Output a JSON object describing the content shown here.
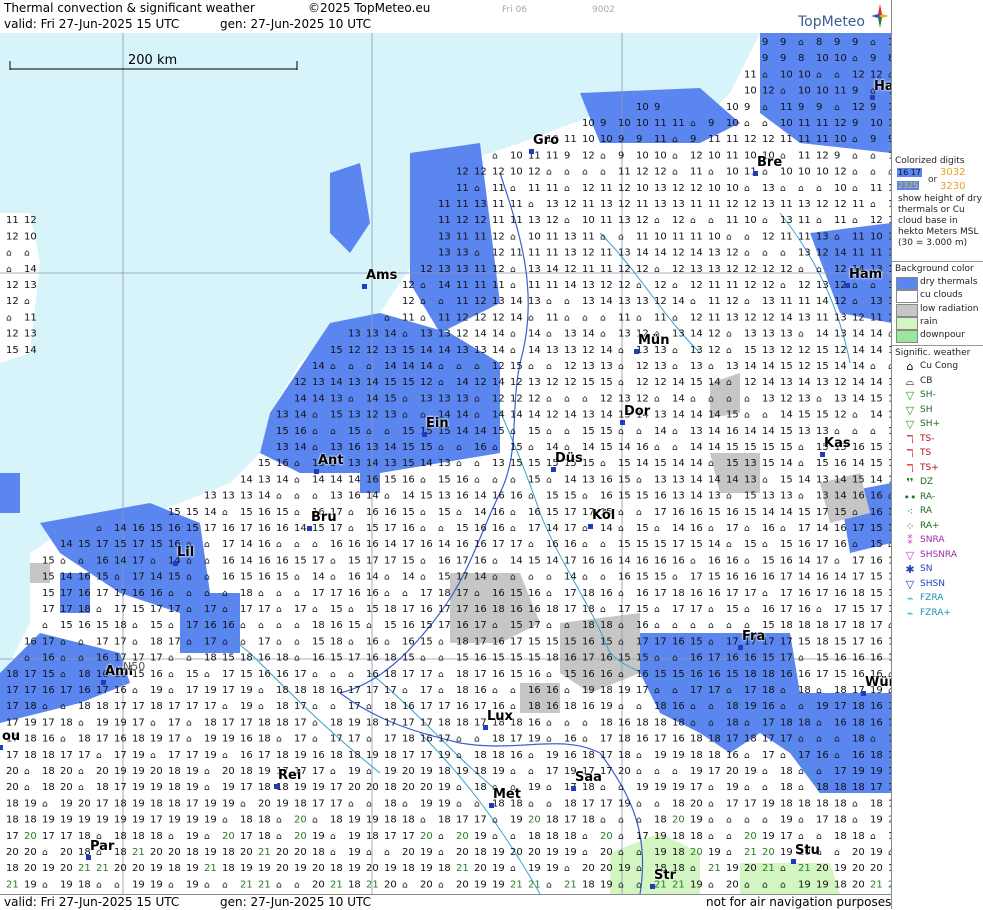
{
  "header": {
    "title": "Thermal convection & significant weather",
    "copyright": "©2025 TopMeteo.eu",
    "valid": "valid:  Fri   27-Jun-2025  15 UTC",
    "gen": "gen:  27-Jun-2025  10 UTC",
    "faint_day": "Fri 06",
    "faint_code": "9002",
    "logo": "TopMeteo"
  },
  "scale_bar": {
    "label": "200 km"
  },
  "footer": {
    "valid": "valid:  Fri   27-Jun-2025  15 UTC",
    "gen": "gen:  27-Jun-2025  10 UTC",
    "notice": "not for air navigation purposes"
  },
  "cities": [
    {
      "name": "Gro"
    },
    {
      "name": "Bre"
    },
    {
      "name": "Ha"
    },
    {
      "name": "Ham"
    },
    {
      "name": "Ams"
    },
    {
      "name": "Mün"
    },
    {
      "name": "Ein"
    },
    {
      "name": "Dor"
    },
    {
      "name": "Kas"
    },
    {
      "name": "Ant"
    },
    {
      "name": "Düs"
    },
    {
      "name": "Bru"
    },
    {
      "name": "Köl"
    },
    {
      "name": "Lil"
    },
    {
      "name": "Fra"
    },
    {
      "name": "Ami"
    },
    {
      "name": "Wür"
    },
    {
      "name": "Lux"
    },
    {
      "name": "Rei"
    },
    {
      "name": "Saa"
    },
    {
      "name": "Met"
    },
    {
      "name": "Par"
    },
    {
      "name": "Stu"
    },
    {
      "name": "Str"
    },
    {
      "name": "ou"
    }
  ],
  "latitude_label": "N50",
  "legend": {
    "colorized_title": "Colorized digits",
    "sample_a": "16 17",
    "sample_b": "3032",
    "sample_or": "or",
    "sample_c": "2325",
    "sample_d": "3230",
    "description": "show height of dry thermals or Cu cloud base in hekto Meters MSL (30 = 3.000 m)",
    "background_title": "Background color",
    "backgrounds": [
      {
        "label": "dry thermals",
        "color": "#5b86f0"
      },
      {
        "label": "cu clouds",
        "color": "#ffffff"
      },
      {
        "label": "low radiation",
        "color": "#c6c6c6"
      },
      {
        "label": "rain",
        "color": "#d2f5c2"
      },
      {
        "label": "downpour",
        "color": "#9be69b"
      }
    ],
    "weather_title": "Signific. weather",
    "weather": [
      {
        "code": "Cu Cong",
        "icon": "cu-cong-icon",
        "glyph": "⌂",
        "color": "#000000"
      },
      {
        "code": "CB",
        "icon": "cb-icon",
        "glyph": "⌓",
        "color": "#000000"
      },
      {
        "code": "SH-",
        "icon": "shower-light-icon",
        "glyph": "▽",
        "color": "#2a9b2a"
      },
      {
        "code": "SH",
        "icon": "shower-icon",
        "glyph": "▽",
        "color": "#2a9b2a"
      },
      {
        "code": "SH+",
        "icon": "shower-heavy-icon",
        "glyph": "▽",
        "color": "#2a9b2a"
      },
      {
        "code": "TS-",
        "icon": "thunderstorm-light-icon",
        "glyph": "ℸ",
        "color": "#d01e1e"
      },
      {
        "code": "TS",
        "icon": "thunderstorm-icon",
        "glyph": "ℸ",
        "color": "#d01e1e"
      },
      {
        "code": "TS+",
        "icon": "thunderstorm-heavy-icon",
        "glyph": "ℸ",
        "color": "#d01e1e"
      },
      {
        "code": "DZ",
        "icon": "drizzle-icon",
        "glyph": "❜❜",
        "color": "#1e7a1e"
      },
      {
        "code": "RA-",
        "icon": "rain-light-icon",
        "glyph": "••",
        "color": "#1e7a1e"
      },
      {
        "code": "RA",
        "icon": "rain-icon",
        "glyph": "⁖",
        "color": "#1e7a1e"
      },
      {
        "code": "RA+",
        "icon": "rain-heavy-icon",
        "glyph": "⁘",
        "color": "#1e7a1e"
      },
      {
        "code": "SNRA",
        "icon": "snow-rain-icon",
        "glyph": "⁑",
        "color": "#c03cc8"
      },
      {
        "code": "SHSNRA",
        "icon": "shower-snow-rain-icon",
        "glyph": "▽",
        "color": "#c03cc8"
      },
      {
        "code": "SN",
        "icon": "snow-icon",
        "glyph": "✱",
        "color": "#2040c0"
      },
      {
        "code": "SHSN",
        "icon": "shower-snow-icon",
        "glyph": "▽",
        "color": "#2040c0"
      },
      {
        "code": "FZRA",
        "icon": "freezing-rain-icon",
        "glyph": "⌁",
        "color": "#22b8d8"
      },
      {
        "code": "FZRA+",
        "icon": "freezing-rain-heavy-icon",
        "glyph": "⌁",
        "color": "#22b8d8"
      }
    ]
  },
  "colors": {
    "sea": "#d7f4fb",
    "dry": "#5b86f0",
    "cu": "#ffffff",
    "lowrad": "#c6c6c6",
    "rain": "#d2f5c2",
    "border": "#3a5fd0"
  }
}
